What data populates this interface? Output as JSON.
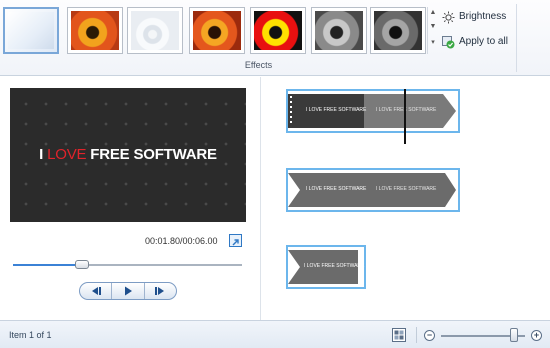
{
  "ribbon": {
    "group_label": "Effects",
    "brightness_label": "Brightness",
    "apply_all_label": "Apply to all",
    "effects": [
      {
        "name": "no-effect"
      },
      {
        "name": "effect-orange"
      },
      {
        "name": "effect-light"
      },
      {
        "name": "effect-warm"
      },
      {
        "name": "effect-posterize"
      },
      {
        "name": "effect-grayscale"
      },
      {
        "name": "effect-dark-grayscale"
      }
    ],
    "icons": {
      "brightness": "sun-icon",
      "apply_all": "apply-check-icon"
    }
  },
  "preview": {
    "logo_part1": "I ",
    "logo_love": "LOVE",
    "logo_part2": " FREE SOFTWARE",
    "time_display": "00:01.80/00:06.00",
    "seek_fraction": 0.3
  },
  "storyboard": {
    "clip_label": "I LOVE FREE SOFTWARE",
    "clips": [
      {
        "index": 1
      },
      {
        "index": 2
      },
      {
        "index": 3
      }
    ]
  },
  "status": {
    "item_text": "Item 1 of 1",
    "zoom_fraction": 0.87
  },
  "colors": {
    "accent": "#3b82d6",
    "clip_border": "#6cb6ec",
    "clip_gray": "#6b6b6b",
    "logo_red": "#e0232b"
  }
}
